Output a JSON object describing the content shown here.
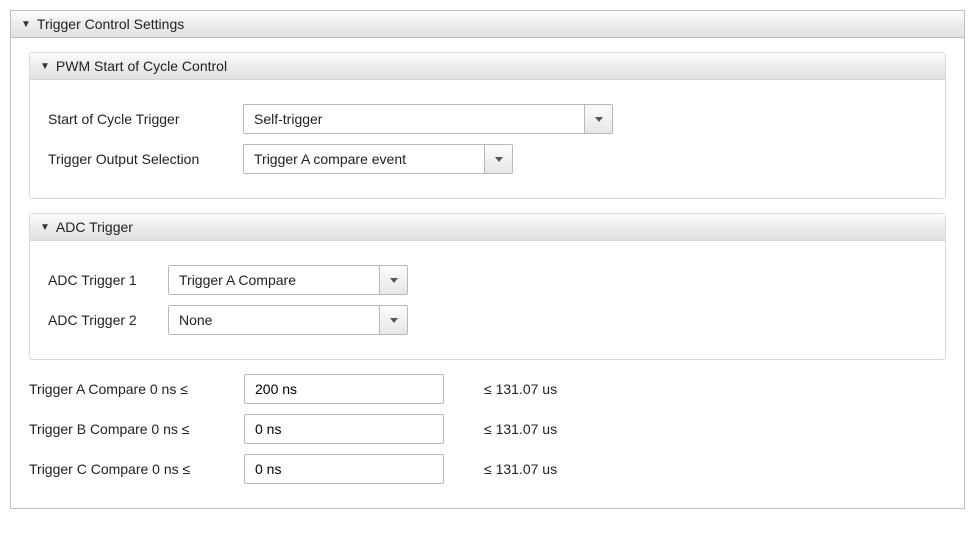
{
  "mainPanel": {
    "title": "Trigger Control Settings"
  },
  "pwmPanel": {
    "title": "PWM Start of Cycle Control",
    "labels": {
      "startOfCycle": "Start of Cycle Trigger",
      "outputSel": "Trigger Output Selection"
    },
    "values": {
      "startOfCycle": "Self-trigger",
      "outputSel": "Trigger A compare event"
    }
  },
  "adcPanel": {
    "title": "ADC Trigger",
    "labels": {
      "t1": "ADC Trigger 1",
      "t2": "ADC Trigger 2"
    },
    "values": {
      "t1": "Trigger A Compare",
      "t2": "None"
    }
  },
  "compareRows": {
    "a": {
      "label": "Trigger A Compare  0 ns  ≤",
      "value": "200 ns",
      "after": "≤  131.07 us"
    },
    "b": {
      "label": "Trigger B Compare  0 ns  ≤",
      "value": "0 ns",
      "after": "≤  131.07 us"
    },
    "c": {
      "label": "Trigger C Compare  0 ns  ≤",
      "value": "0 ns",
      "after": "≤  131.07 us"
    }
  }
}
